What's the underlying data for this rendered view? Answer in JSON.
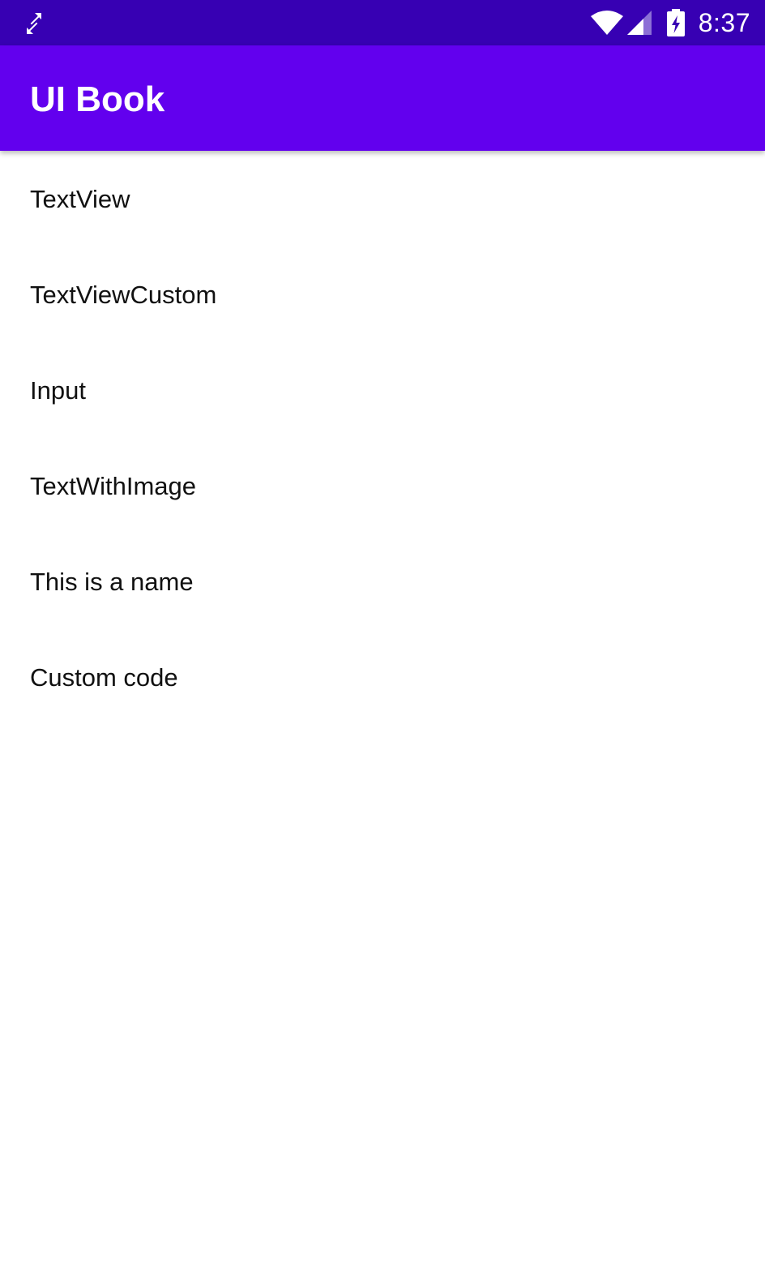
{
  "status_bar": {
    "time": "8:37",
    "background_color": "#3700b3",
    "icons": [
      "sync-arrows-icon",
      "wifi-icon",
      "cell-signal-icon",
      "battery-charging-icon"
    ]
  },
  "app_bar": {
    "title": "UI Book",
    "background_color": "#6200ee"
  },
  "list": {
    "items": [
      {
        "label": "TextView"
      },
      {
        "label": "TextViewCustom"
      },
      {
        "label": "Input"
      },
      {
        "label": "TextWithImage"
      },
      {
        "label": "This is a name"
      },
      {
        "label": "Custom code"
      }
    ]
  }
}
